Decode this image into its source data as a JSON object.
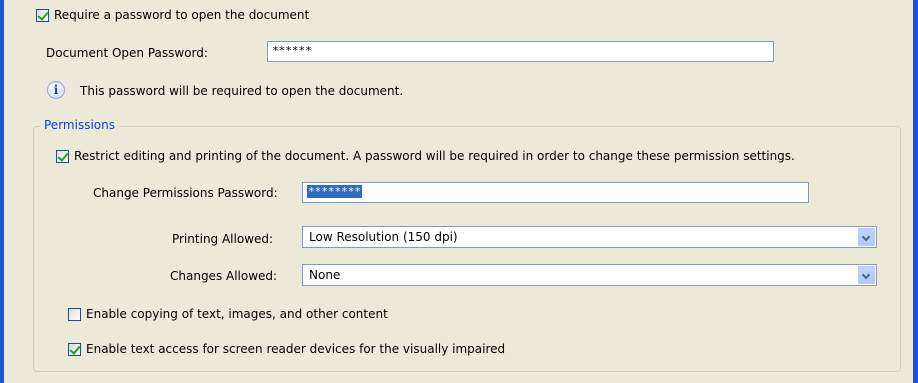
{
  "open_password_section": {
    "require_checkbox": {
      "label": "Require a password to open the document",
      "checked": true
    },
    "field_label": "Document Open Password:",
    "field_value": "******",
    "info_text": "This password will be required to open the document."
  },
  "permissions": {
    "legend": "Permissions",
    "restrict_checkbox": {
      "label": "Restrict editing and printing of the document. A password will be required in order to change these permission settings.",
      "checked": true
    },
    "change_password_label": "Change Permissions Password:",
    "change_password_value": "********",
    "printing_label": "Printing Allowed:",
    "printing_value": "Low Resolution (150 dpi)",
    "changes_label": "Changes Allowed:",
    "changes_value": "None",
    "copy_checkbox": {
      "label": "Enable copying of text, images, and other content",
      "checked": false
    },
    "screen_reader_checkbox": {
      "label": "Enable text access for screen reader devices for the visually impaired",
      "checked": true
    }
  },
  "colors": {
    "dialog_bg": "#ece9d8",
    "frame_blue": "#1f56d8",
    "legend_blue": "#0046d5",
    "selection_blue": "#316ac5",
    "check_green": "#21a121"
  }
}
